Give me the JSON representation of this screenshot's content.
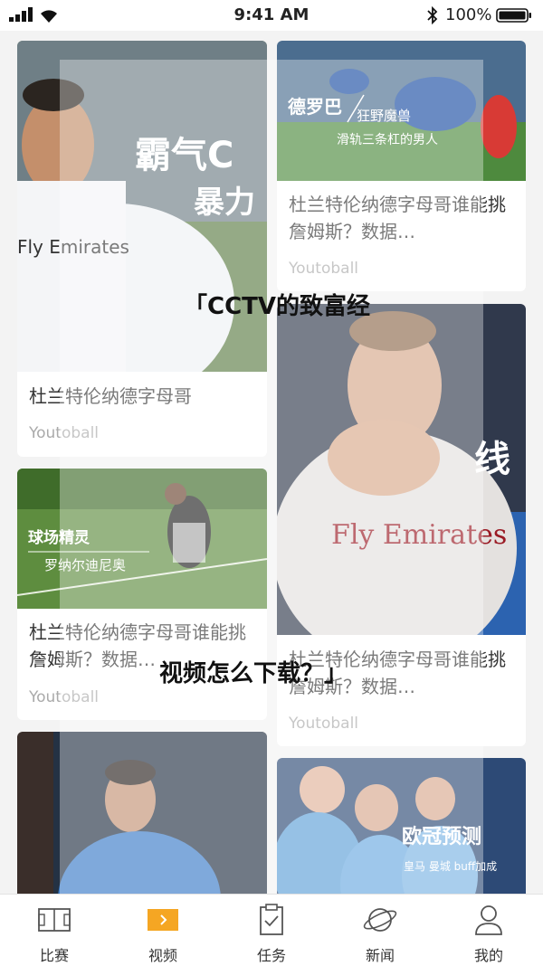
{
  "status_bar": {
    "time": "9:41 AM",
    "battery": "100%"
  },
  "cards": [
    {
      "title": "杜兰特伦纳德字母哥",
      "source": "Youtoball",
      "banner_main": "霸气C",
      "banner_sub": "暴力"
    },
    {
      "title": "杜兰特伦纳德字母哥谁能挑詹姆斯？数据…",
      "source": "Youtoball",
      "banner_main": "德罗巴",
      "banner_sub": "狂野魔兽",
      "banner_caption": "滑轨三条杠的男人"
    },
    {
      "title": "杜兰特伦纳德字母哥谁能挑詹姆斯？数据…",
      "source": "Youtoball",
      "banner_main": "球场精灵",
      "banner_sub": "罗纳尔迪尼奥"
    },
    {
      "title": "杜兰特伦纳德字母哥谁能挑詹姆斯？数据…",
      "source": "Youtoball",
      "banner_main": "线",
      "jersey": "Fly Emirates"
    },
    {
      "title": "",
      "source": ""
    },
    {
      "title": "",
      "source": "",
      "banner_main": "欧冠预测",
      "banner_sub": "皇马 曼城 buff加成"
    }
  ],
  "watermark": {
    "line1": "「CCTV的致富经",
    "line2": "视频怎么下载？」"
  },
  "tab_bar": {
    "items": [
      {
        "label": "比赛"
      },
      {
        "label": "视频"
      },
      {
        "label": "任务"
      },
      {
        "label": "新闻"
      },
      {
        "label": "我的"
      }
    ],
    "active_color": "#f5a623"
  },
  "jersey_text": "Fly Emirates"
}
